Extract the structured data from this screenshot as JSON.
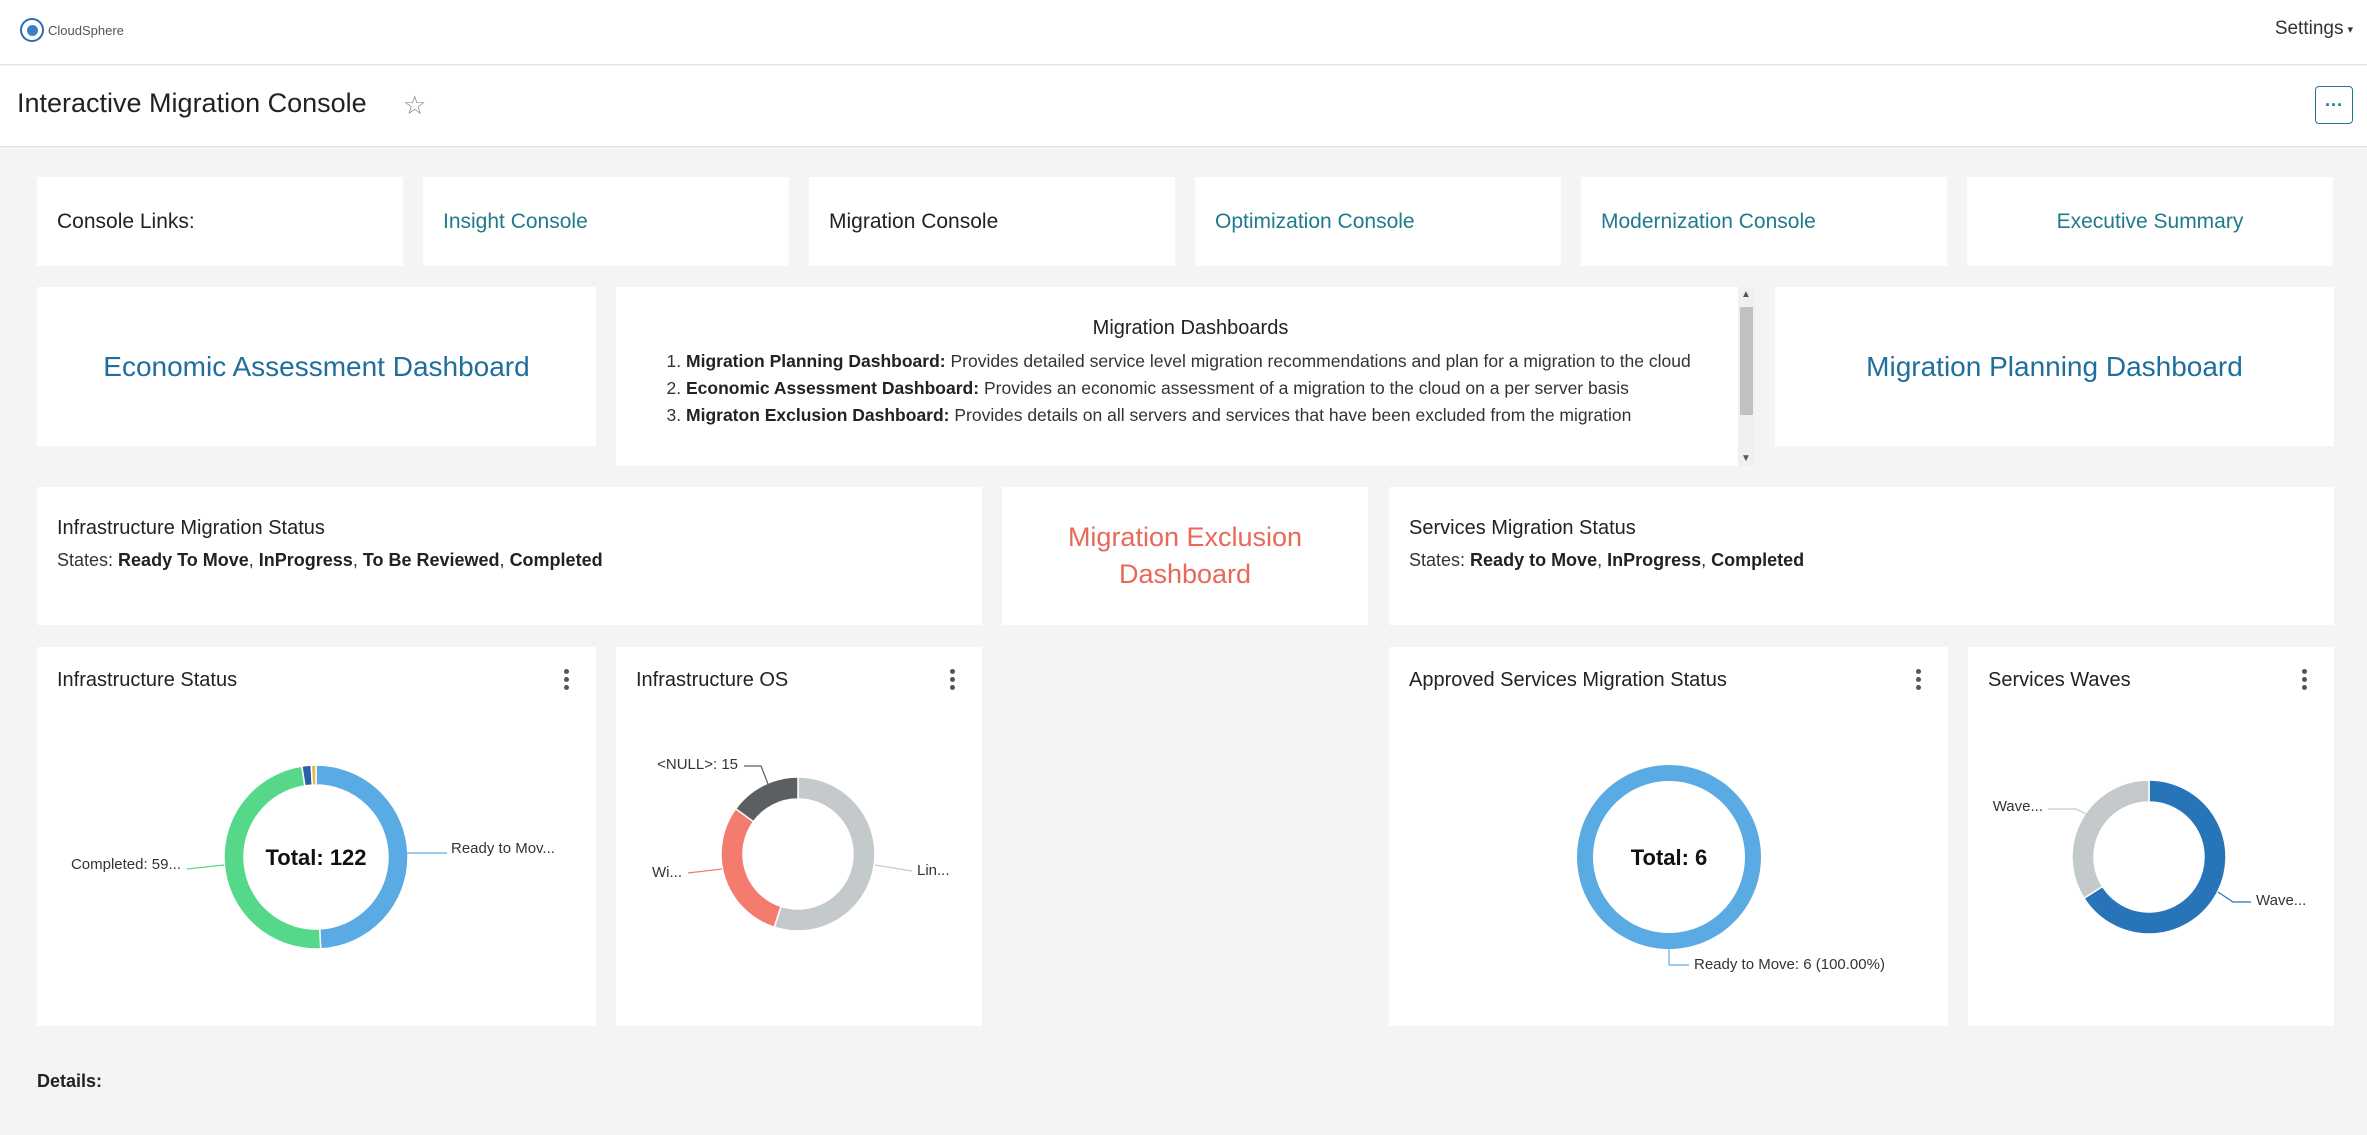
{
  "app": {
    "brand": "CloudSphere",
    "settings_label": "Settings"
  },
  "page": {
    "title": "Interactive Migration Console",
    "more_label": "···"
  },
  "console_links": {
    "label": "Console Links:",
    "items": [
      "Insight Console",
      "Migration Console",
      "Optimization Console",
      "Modernization Console",
      "Executive Summary"
    ]
  },
  "dashboards": {
    "economic": "Economic Assessment Dashboard",
    "planning": "Migration Planning Dashboard",
    "exclusion": "Migration Exclusion Dashboard",
    "list_title": "Migration Dashboards",
    "list": [
      {
        "name": "Migration Planning Dashboard:",
        "desc": "Provides detailed service level migration recommendations and plan for a migration to the cloud"
      },
      {
        "name": "Economic Assessment Dashboard:",
        "desc": "Provides an economic assessment of a migration to the cloud on a per server basis"
      },
      {
        "name": "Migraton Exclusion Dashboard:",
        "desc": "Provides details on all servers and services that have been excluded from the migration"
      }
    ]
  },
  "infra_status_card": {
    "title": "Infrastructure Migration Status",
    "states_label": "States:",
    "states": [
      "Ready To Move",
      "InProgress",
      "To Be Reviewed",
      "Completed"
    ]
  },
  "services_status_card": {
    "title": "Services Migration Status",
    "states_label": "States:",
    "states": [
      "Ready to Move",
      "InProgress",
      "Completed"
    ]
  },
  "details_label": "Details:",
  "colors": {
    "teal": "#1f7a8c",
    "blue": "#5aaae3",
    "green": "#56d88a",
    "red": "#f47c6f",
    "grey": "#c4cacb",
    "dark": "#5b5f62",
    "navy": "#2874b8"
  },
  "chart_data": [
    {
      "type": "pie",
      "title": "Infrastructure Status",
      "center_label": "Total: 122",
      "slices": [
        {
          "label": "Ready to Mov...",
          "value": 60,
          "color": "#5aaae3"
        },
        {
          "label": "Completed: 59...",
          "value": 59,
          "color": "#56d88a"
        },
        {
          "label": "",
          "value": 2,
          "color": "#2b5fa8"
        },
        {
          "label": "",
          "value": 1,
          "color": "#e0b94a"
        }
      ]
    },
    {
      "type": "pie",
      "title": "Infrastructure OS",
      "slices": [
        {
          "label": "Lin...",
          "value": 55,
          "color": "#c4cacb"
        },
        {
          "label": "Wi...",
          "value": 30,
          "color": "#f47c6f"
        },
        {
          "label": "<NULL>: 15",
          "value": 15,
          "color": "#5b5f62"
        }
      ]
    },
    {
      "type": "pie",
      "title": "Approved Services Migration Status",
      "center_label": "Total: 6",
      "slices": [
        {
          "label": "Ready to Move: 6 (100.00%)",
          "value": 6,
          "color": "#5aaae3"
        }
      ]
    },
    {
      "type": "pie",
      "title": "Services Waves",
      "slices": [
        {
          "label": "Wave...",
          "value": 66,
          "color": "#2874b8"
        },
        {
          "label": "Wave...",
          "value": 34,
          "color": "#c4cacb"
        }
      ]
    }
  ]
}
